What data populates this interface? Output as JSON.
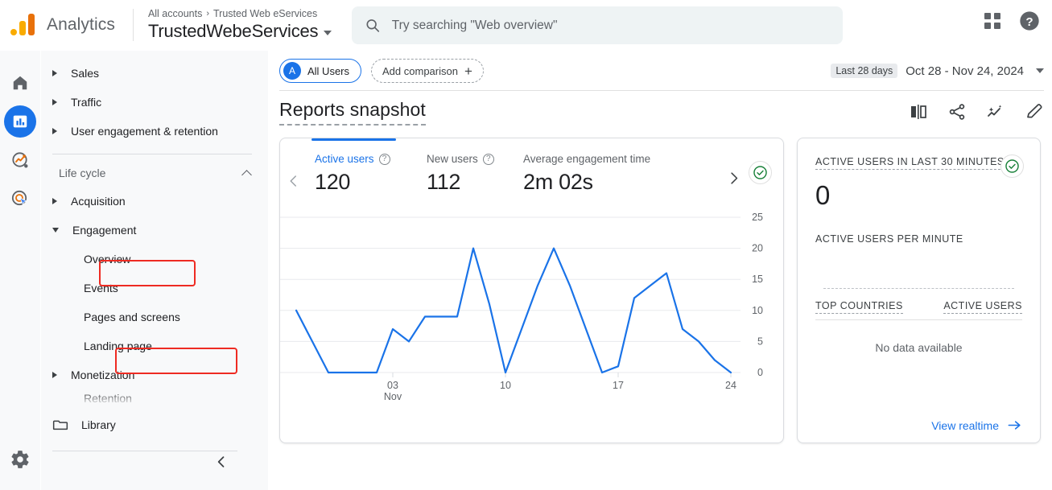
{
  "header": {
    "brand": "Analytics",
    "breadcrumb_all": "All accounts",
    "breadcrumb_sep": "›",
    "breadcrumb_account": "Trusted Web eServices",
    "property": "TrustedWebeServices",
    "search_placeholder": "Try searching \"Web overview\"",
    "apps_icon": "apps-grid-icon",
    "help_icon": "help-question-icon",
    "logo_icon": "google-analytics-logo"
  },
  "rail": {
    "items": [
      {
        "name": "home-icon",
        "label": "Home",
        "active": false
      },
      {
        "name": "reports-bar-chart-icon",
        "label": "Reports",
        "active": true
      },
      {
        "name": "explore-icon",
        "label": "Explore",
        "active": false
      },
      {
        "name": "advertising-target-icon",
        "label": "Advertising",
        "active": false
      }
    ],
    "settings_icon": "gear-icon"
  },
  "sidebar": {
    "top_items": [
      {
        "label": "Sales",
        "expanded": false
      },
      {
        "label": "Traffic",
        "expanded": false
      },
      {
        "label": "User engagement & retention",
        "expanded": false
      }
    ],
    "section_label": "Life cycle",
    "section_collapse_icon": "chevron-up-icon",
    "lifecycle_items": [
      {
        "label": "Acquisition",
        "expanded": false,
        "highlighted": false
      },
      {
        "label": "Engagement",
        "expanded": true,
        "highlighted": true
      }
    ],
    "engagement_children": [
      {
        "label": "Overview",
        "highlighted": false
      },
      {
        "label": "Events",
        "highlighted": false
      },
      {
        "label": "Pages and screens",
        "highlighted": true
      },
      {
        "label": "Landing page",
        "highlighted": false
      }
    ],
    "monetization": {
      "label": "Monetization",
      "expanded": false
    },
    "retention": {
      "label": "Retention"
    },
    "library": {
      "label": "Library",
      "icon": "folder-icon"
    },
    "collapse_icon": "chevron-left-icon",
    "highlight_color": "#ee2b22"
  },
  "main": {
    "comparison": {
      "all_users_label": "All Users",
      "all_users_avatar": "A",
      "add_comparison_label": "Add comparison",
      "add_icon": "plus-icon"
    },
    "date_range": {
      "preset": "Last 28 days",
      "range": "Oct 28 - Nov 24, 2024",
      "dropdown_icon": "caret-down-icon"
    },
    "page_title": "Reports snapshot",
    "title_icons": [
      {
        "name": "compare-split-icon"
      },
      {
        "name": "share-icon"
      },
      {
        "name": "insights-sparkle-icon"
      },
      {
        "name": "edit-pencil-icon"
      }
    ],
    "metric_card": {
      "prev_icon": "chevron-left-icon",
      "next_icon": "chevron-right-icon",
      "status_icon": "check-circle-icon",
      "status_color": "#188038",
      "metrics": [
        {
          "label": "Active users",
          "value": "120",
          "selected": true,
          "help_icon": "help-circle-icon"
        },
        {
          "label": "New users",
          "value": "112",
          "selected": false,
          "help_icon": "help-circle-icon"
        },
        {
          "label": "Average engagement time",
          "value": "2m 02s",
          "selected": false,
          "help_icon": ""
        }
      ]
    },
    "realtime_card": {
      "title": "ACTIVE USERS IN LAST 30 MINUTES",
      "value": "0",
      "per_minute_label": "ACTIVE USERS PER MINUTE",
      "status_icon": "check-circle-icon",
      "col_country": "TOP COUNTRIES",
      "col_users": "ACTIVE USERS",
      "no_data": "No data available",
      "view_realtime": "View realtime",
      "view_realtime_icon": "arrow-right-icon"
    }
  },
  "chart_data": {
    "type": "line",
    "title": "Active users",
    "xlabel": "",
    "ylabel": "",
    "ylim": [
      0,
      25
    ],
    "yticks": [
      0,
      5,
      10,
      15,
      20,
      25
    ],
    "grid": true,
    "legend": false,
    "line_color": "#1a73e8",
    "xticks": [
      {
        "index": 6,
        "label": "03",
        "sublabel": "Nov"
      },
      {
        "index": 13,
        "label": "10",
        "sublabel": ""
      },
      {
        "index": 20,
        "label": "17",
        "sublabel": ""
      },
      {
        "index": 27,
        "label": "24",
        "sublabel": ""
      }
    ],
    "x": [
      "Oct 28",
      "Oct 29",
      "Oct 30",
      "Oct 31",
      "Nov 01",
      "Nov 02",
      "Nov 03",
      "Nov 04",
      "Nov 05",
      "Nov 06",
      "Nov 07",
      "Nov 08",
      "Nov 09",
      "Nov 10",
      "Nov 11",
      "Nov 12",
      "Nov 13",
      "Nov 14",
      "Nov 15",
      "Nov 16",
      "Nov 17",
      "Nov 18",
      "Nov 19",
      "Nov 20",
      "Nov 21",
      "Nov 22",
      "Nov 23",
      "Nov 24"
    ],
    "values": [
      10,
      5,
      0,
      0,
      0,
      0,
      7,
      5,
      9,
      9,
      9,
      20,
      11,
      0,
      7,
      14,
      20,
      14,
      7,
      0,
      1,
      12,
      14,
      16,
      7,
      5,
      2,
      0
    ]
  }
}
